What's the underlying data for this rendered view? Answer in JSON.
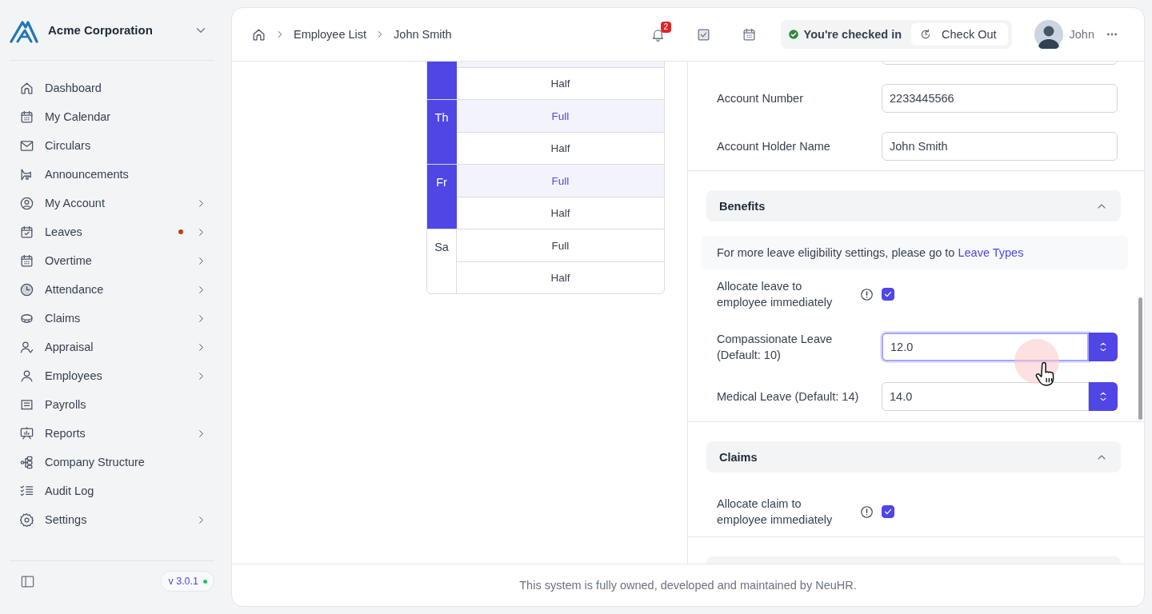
{
  "sidebar": {
    "company": "Acme Corporation",
    "items": [
      {
        "label": "Dashboard",
        "has_submenu": false,
        "dot": false
      },
      {
        "label": "My Calendar",
        "has_submenu": false,
        "dot": false
      },
      {
        "label": "Circulars",
        "has_submenu": false,
        "dot": false
      },
      {
        "label": "Announcements",
        "has_submenu": false,
        "dot": false
      },
      {
        "label": "My Account",
        "has_submenu": true,
        "dot": false
      },
      {
        "label": "Leaves",
        "has_submenu": true,
        "dot": true
      },
      {
        "label": "Overtime",
        "has_submenu": true,
        "dot": false
      },
      {
        "label": "Attendance",
        "has_submenu": true,
        "dot": false
      },
      {
        "label": "Claims",
        "has_submenu": true,
        "dot": false
      },
      {
        "label": "Appraisal",
        "has_submenu": true,
        "dot": false
      },
      {
        "label": "Employees",
        "has_submenu": true,
        "dot": false
      },
      {
        "label": "Payrolls",
        "has_submenu": false,
        "dot": false
      },
      {
        "label": "Reports",
        "has_submenu": true,
        "dot": false
      },
      {
        "label": "Company Structure",
        "has_submenu": false,
        "dot": false
      },
      {
        "label": "Audit Log",
        "has_submenu": false,
        "dot": false
      },
      {
        "label": "Settings",
        "has_submenu": true,
        "dot": false
      }
    ],
    "version": "v 3.0.1"
  },
  "header": {
    "breadcrumbs": [
      "Employee List",
      "John Smith"
    ],
    "notification_count": "2",
    "check_in": {
      "status": "You're checked in",
      "button": "Check Out"
    },
    "user": {
      "name": "John"
    }
  },
  "schedule": {
    "days": [
      {
        "selected": true,
        "options": [
          {
            "selected": true
          },
          {
            "label": "Half",
            "selected": false
          }
        ]
      },
      {
        "label": "Th",
        "selected": true,
        "options": [
          {
            "label": "Full",
            "selected": true
          },
          {
            "label": "Half",
            "selected": false
          }
        ]
      },
      {
        "label": "Fr",
        "selected": true,
        "options": [
          {
            "label": "Full",
            "selected": true
          },
          {
            "label": "Half",
            "selected": false
          }
        ]
      },
      {
        "label": "Sa",
        "selected": false,
        "options": [
          {
            "label": "Full",
            "selected": false
          },
          {
            "label": "Half",
            "selected": false
          }
        ]
      }
    ]
  },
  "form": {
    "blocks": [
      {
        "kind": "field"
      },
      {
        "kind": "field",
        "label": "Account Number",
        "value": "2233445566"
      },
      {
        "kind": "field",
        "label": "Account Holder Name",
        "value": "John Smith"
      },
      {
        "kind": "divider"
      },
      {
        "kind": "section",
        "title": "Benefits",
        "expanded": true
      },
      {
        "kind": "info",
        "text": "For more leave eligibility settings, please go to",
        "link": "Leave Types"
      },
      {
        "kind": "checkbox",
        "label": "Allocate leave to employee immediately",
        "checked": true
      },
      {
        "kind": "number",
        "label": "Compassionate Leave (Default: 10)",
        "value": "12.0",
        "focused": true
      },
      {
        "kind": "number",
        "label": "Medical Leave (Default: 14)",
        "value": "14.0",
        "focused": false
      },
      {
        "kind": "divider"
      },
      {
        "kind": "section",
        "title": "Claims",
        "expanded": true
      },
      {
        "kind": "checkbox",
        "label": "Allocate claim to employee immediately",
        "checked": true
      },
      {
        "kind": "divider"
      },
      {
        "kind": "section"
      }
    ]
  },
  "footer": {
    "text": "This system is fully owned, developed and maintained by NeuHR."
  }
}
